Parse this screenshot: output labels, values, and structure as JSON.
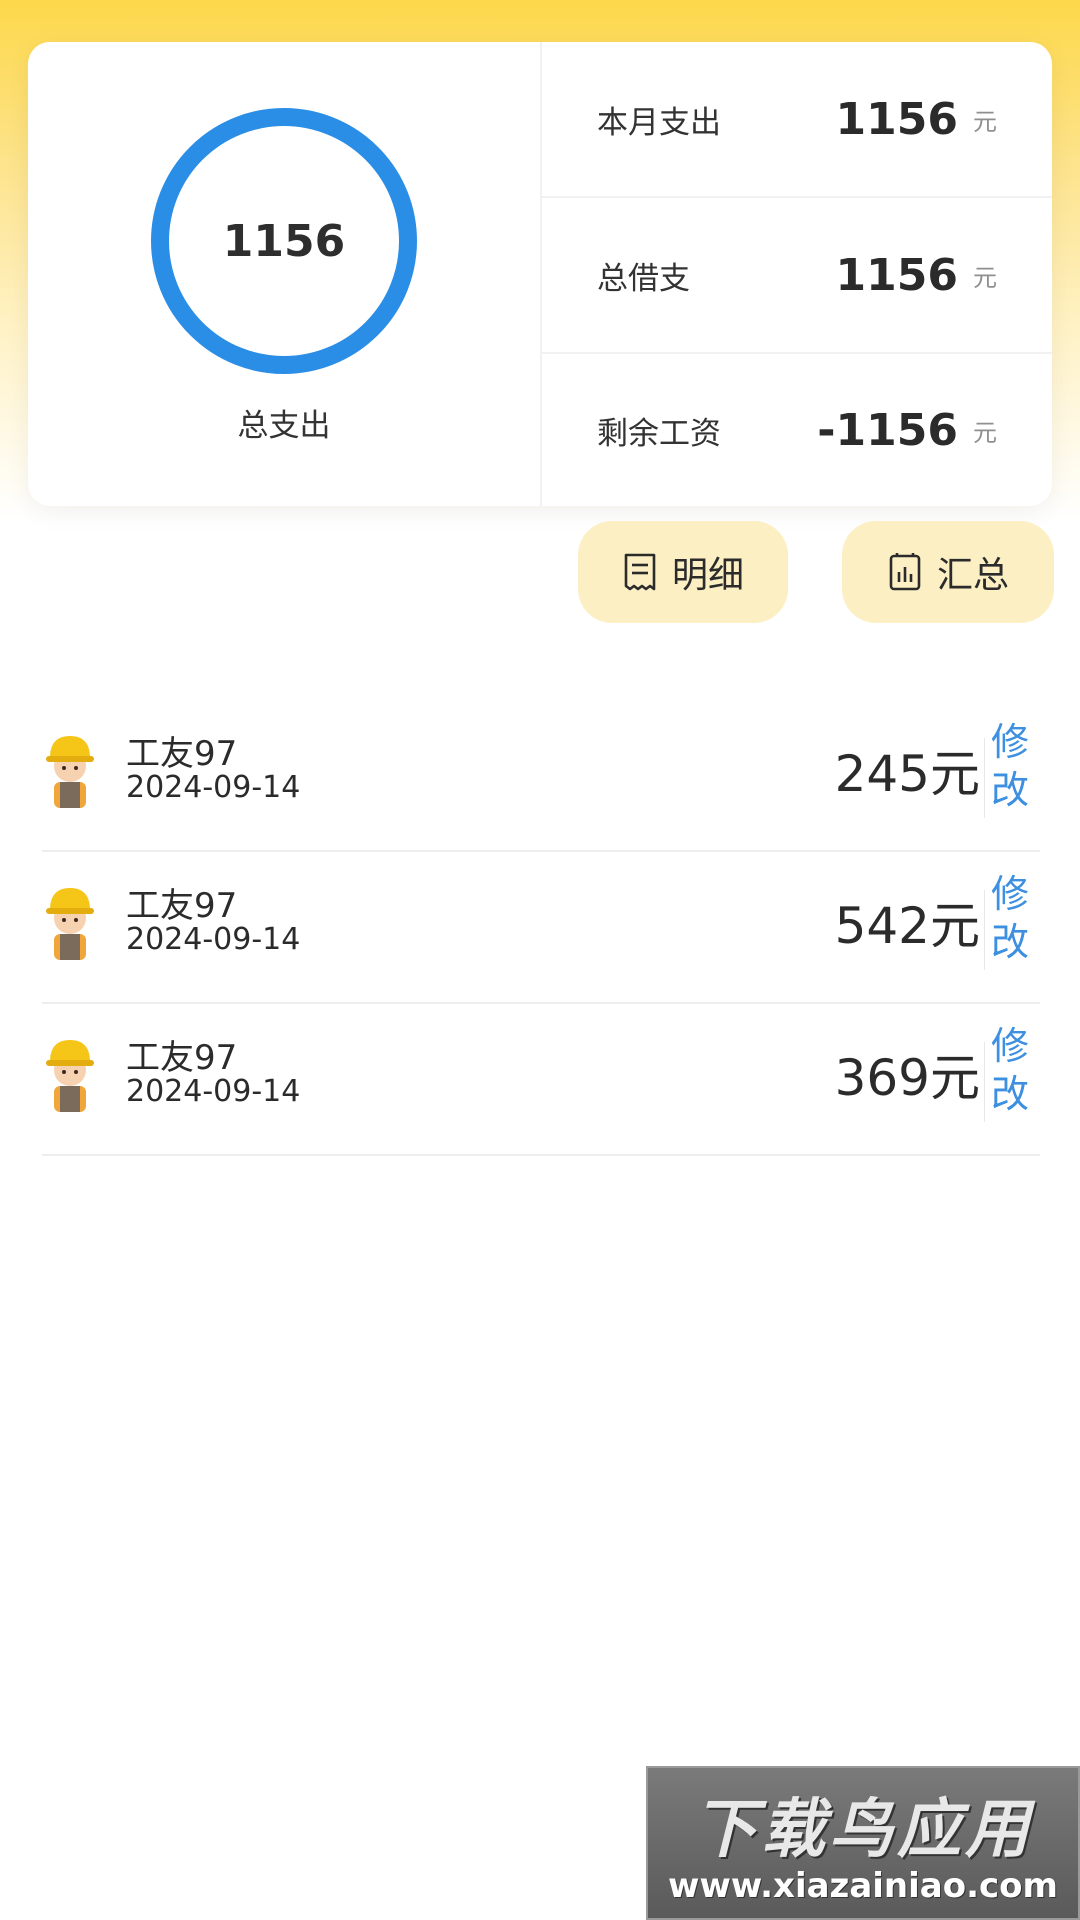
{
  "summary": {
    "total_value": "1156",
    "total_label": "总支出",
    "stats": [
      {
        "label": "本月支出",
        "value": "1156",
        "unit": "元"
      },
      {
        "label": "总借支",
        "value": "1156",
        "unit": "元"
      },
      {
        "label": "剩余工资",
        "value": "-1156",
        "unit": "元"
      }
    ]
  },
  "actions": {
    "detail_label": "明细",
    "detail_icon": "receipt-icon",
    "summary_label": "汇总",
    "summary_icon": "calculator-icon"
  },
  "records": [
    {
      "name": "工友97",
      "date": "2024-09-14",
      "amount": "245元",
      "edit_label": "修改",
      "avatar_icon": "worker-avatar-icon"
    },
    {
      "name": "工友97",
      "date": "2024-09-14",
      "amount": "542元",
      "edit_label": "修改",
      "avatar_icon": "worker-avatar-icon"
    },
    {
      "name": "工友97",
      "date": "2024-09-14",
      "amount": "369元",
      "edit_label": "修改",
      "avatar_icon": "worker-avatar-icon"
    }
  ],
  "watermark": {
    "title": "下载鸟应用",
    "url": "www.xiazainiao.com"
  },
  "colors": {
    "accent_yellow": "#fdd84a",
    "ring_blue": "#2a8ee6",
    "pill_bg": "#fbefc3",
    "edit_blue": "#3d8fe0"
  }
}
